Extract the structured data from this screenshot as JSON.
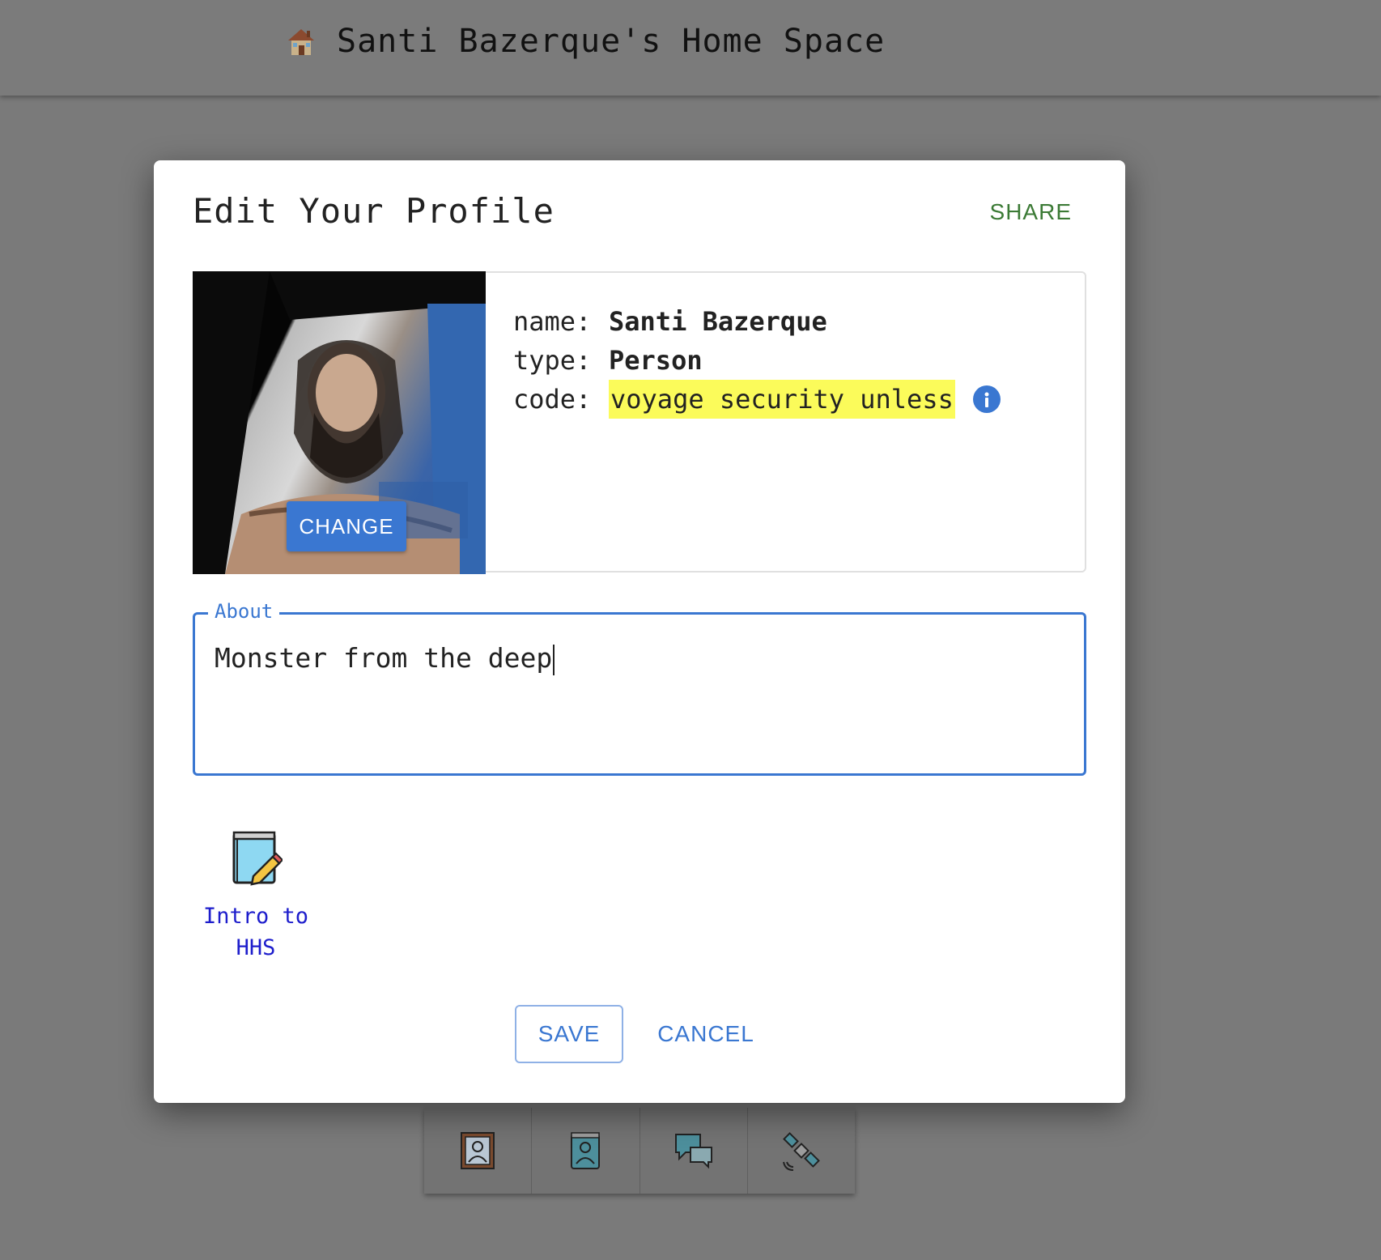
{
  "appbar": {
    "title": "Santi Bazerque's Home Space",
    "icon": "house-icon"
  },
  "dialog": {
    "title": "Edit Your Profile",
    "share_label": "SHARE",
    "photo": {
      "change_label": "CHANGE"
    },
    "fields": {
      "name_key": "name:",
      "name_value": "Santi Bazerque",
      "type_key": "type:",
      "type_value": "Person",
      "code_key": "code:",
      "code_value": "voyage security unless",
      "code_info_icon": "info-icon"
    },
    "about": {
      "label": "About",
      "value": "Monster from the deep"
    },
    "intro_link": {
      "icon": "notebook-pencil-icon",
      "label_line1": "Intro to",
      "label_line2": "HHS"
    },
    "save_label": "SAVE",
    "cancel_label": "CANCEL"
  },
  "bottom_toolbar": {
    "items": [
      {
        "icon": "profile-portrait-icon"
      },
      {
        "icon": "contacts-book-icon"
      },
      {
        "icon": "chat-bubbles-icon"
      },
      {
        "icon": "satellite-icon"
      }
    ]
  },
  "colors": {
    "accent": "#3a77d1",
    "share": "#3b7a35",
    "highlight": "#fbfb5a",
    "link": "#1d1dcc"
  }
}
